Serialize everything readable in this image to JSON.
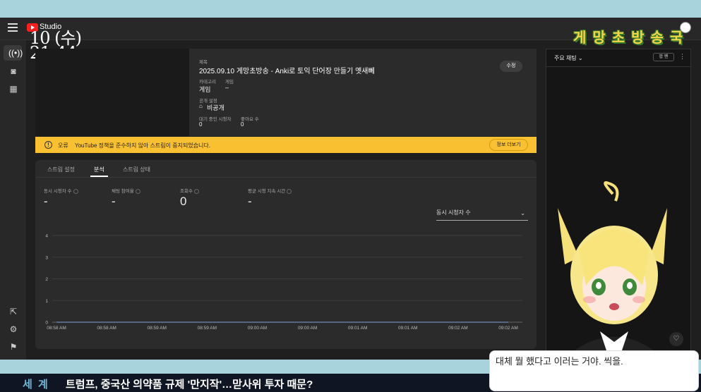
{
  "app": {
    "title": "Studio"
  },
  "overlay": {
    "day": "10 (수)",
    "time": "21:44",
    "brand": "게 망 초 방 송 국"
  },
  "stream": {
    "title_label": "제목",
    "title": "2025.09.10 게망초방송 - Anki로 토익 단어장 만들기 옛새뻬",
    "category_label": "카테고리",
    "category": "게임",
    "game_label": "게임",
    "game": "–",
    "visibility_label": "공개 설정",
    "visibility": "비공개",
    "waiting_label": "대기 중인 시청자",
    "waiting": "0",
    "likes_label": "좋아요 수",
    "likes": "0",
    "edit_label": "수정"
  },
  "error": {
    "label": "오류",
    "message": "YouTube 정책을 준수하지 않아 스트림이 중지되었습니다.",
    "more_label": "정보 더보기"
  },
  "tabs": [
    "스트림 설정",
    "분석",
    "스트림 상태"
  ],
  "metrics": [
    {
      "label": "동시 시청자 수",
      "value": "-"
    },
    {
      "label": "채팅 참여율",
      "value": "-"
    },
    {
      "label": "조회수",
      "value": "0"
    },
    {
      "label": "평균 시청 지속 시간",
      "value": "-"
    }
  ],
  "chart_select": {
    "selected": "동시 시청자 수"
  },
  "chart_data": {
    "type": "line",
    "x": [
      "08:58 AM",
      "08:58 AM",
      "08:59 AM",
      "08:59 AM",
      "09:00 AM",
      "09:00 AM",
      "09:01 AM",
      "09:01 AM",
      "09:02 AM",
      "09:02 AM"
    ],
    "series": [
      {
        "values": [
          0,
          0,
          0,
          0,
          0,
          0,
          0,
          0,
          0,
          0
        ]
      }
    ],
    "yticks": [
      "0",
      "1",
      "2",
      "3",
      "4"
    ],
    "ylim": [
      0,
      4
    ],
    "grid": true
  },
  "chat": {
    "title": "주요 채팅",
    "pill": "팝 팬"
  },
  "ticker": {
    "label": "세 계",
    "text": "트럼프, 중국산 의약품 규제 '만지작'…맏사위 투자 때문?"
  },
  "speech": {
    "text": "대체 뭘 했다고 이러는 거야. 씩을."
  },
  "colors": {
    "accent_error": "#f9c031",
    "brand_red": "#ff1e1e",
    "ticker_label": "#6fb6d6"
  }
}
